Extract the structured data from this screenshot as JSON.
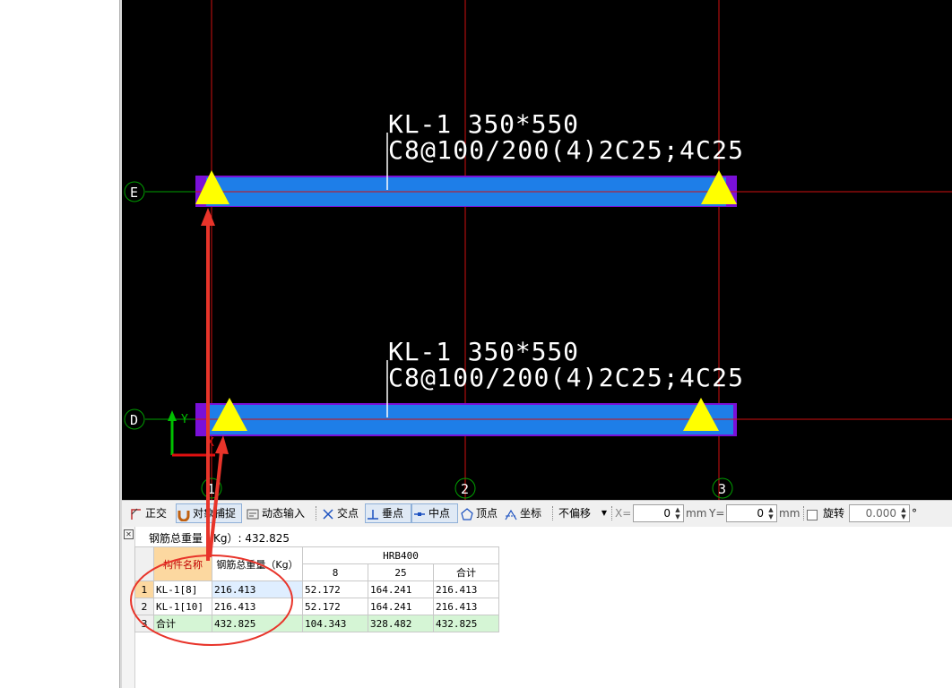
{
  "canvas": {
    "axis_labels": {
      "row_e": "E",
      "row_d": "D",
      "col_1": "1",
      "col_2": "2",
      "col_3": "3"
    },
    "beam_top": {
      "line1": "KL-1 350*550",
      "line2": "C8@100/200(4)2C25;4C25"
    },
    "beam_bottom": {
      "line1": "KL-1 350*550",
      "line2": "C8@100/200(4)2C25;4C25"
    },
    "ucs": {
      "y_label": "Y",
      "x_label": "X"
    },
    "colors": {
      "beam": "#1e7ee8",
      "support": "#7a10d8",
      "marker": "#ffff00",
      "axis": "#d01010",
      "grid_green": "#00a000",
      "annotation": "#e8342a"
    }
  },
  "toolbar": {
    "orthogonal": "正交",
    "object_snap": "对象捕捉",
    "dynamic_input": "动态输入",
    "intersection": "交点",
    "perpendicular": "垂点",
    "midpoint": "中点",
    "vertex": "顶点",
    "coordinate": "坐标",
    "offset_mode": "不偏移",
    "x_label": "X=",
    "x_value": "0",
    "x_unit": "mm",
    "y_label": "Y=",
    "y_value": "0",
    "y_unit": "mm",
    "rotate_label": "旋转",
    "rotate_value": "0.000",
    "degree": "°"
  },
  "report": {
    "title": "钢筋总重量（Kg）: 432.825",
    "headers": {
      "name": "构件名称",
      "total_weight": "钢筋总重量（Kg）",
      "grade": "HRB400",
      "d8": "8",
      "d25": "25",
      "subtotal": "合计"
    },
    "rows": [
      {
        "num": "1",
        "name": "KL-1[8]",
        "total": "216.413",
        "d8": "52.172",
        "d25": "164.241",
        "sum": "216.413"
      },
      {
        "num": "2",
        "name": "KL-1[10]",
        "total": "216.413",
        "d8": "52.172",
        "d25": "164.241",
        "sum": "216.413"
      },
      {
        "num": "3",
        "name": "合计",
        "total": "432.825",
        "d8": "104.343",
        "d25": "328.482",
        "sum": "432.825"
      }
    ]
  }
}
